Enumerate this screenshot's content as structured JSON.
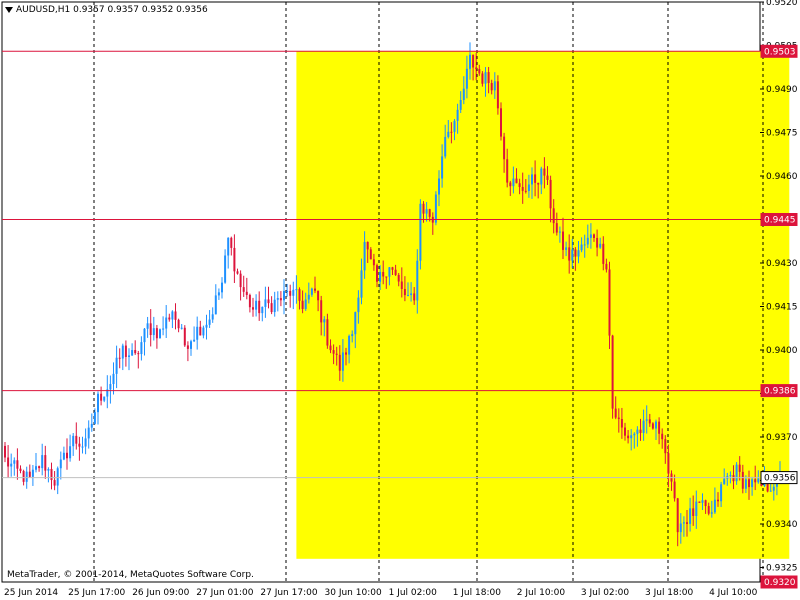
{
  "window": {
    "symbol_line": "AUDUSD,H1  0.9357 0.9357 0.9352 0.9356",
    "copyright": "MetaTrader, © 2001-2014, MetaQuotes Software Corp."
  },
  "colors": {
    "background": "#ffffff",
    "highlight": "#ffff00",
    "bull": "#1e90ff",
    "bear": "#dc143c",
    "level_line": "#dc143c",
    "grid": "#000000",
    "current_price_line": "#c0c0c0"
  },
  "chart_data": {
    "type": "candlestick",
    "title": "",
    "xlabel": "",
    "ylabel": "",
    "symbol": "AUDUSD",
    "timeframe": "H1",
    "ylim": [
      0.932,
      0.952
    ],
    "ytick_labels": [
      "0.9520",
      "0.9505",
      "0.9490",
      "0.9475",
      "0.9460",
      "0.9445",
      "0.9430",
      "0.9415",
      "0.9400",
      "0.9385",
      "0.9370",
      "0.9355",
      "0.9340",
      "0.9325"
    ],
    "x_tick_labels": [
      "25 Jun 2014",
      "25 Jun 17:00",
      "26 Jun 09:00",
      "27 Jun 01:00",
      "27 Jun 17:00",
      "30 Jun 10:00",
      "1 Jul 02:00",
      "1 Jul 18:00",
      "2 Jul 10:00",
      "3 Jul 02:00",
      "3 Jul 18:00",
      "4 Jul 10:00"
    ],
    "horizontal_levels": [
      {
        "price": 0.9503,
        "label": "0.9503"
      },
      {
        "price": 0.9445,
        "label": "0.9445"
      },
      {
        "price": 0.9386,
        "label": "0.9386"
      }
    ],
    "current_price": {
      "price": 0.9356,
      "label": "0.9356"
    },
    "axis_bottom_label": "0.9320",
    "highlight_zone": {
      "from_candle": 94,
      "to_candle": 253,
      "price_top": 0.9503,
      "price_bottom": 0.9328
    },
    "close_path": [
      [
        0,
        0.9362
      ],
      [
        4,
        0.9358
      ],
      [
        8,
        0.9355
      ],
      [
        12,
        0.9362
      ],
      [
        16,
        0.9355
      ],
      [
        20,
        0.9365
      ],
      [
        22,
        0.9369
      ],
      [
        26,
        0.9367
      ],
      [
        30,
        0.9383
      ],
      [
        34,
        0.9389
      ],
      [
        38,
        0.94
      ],
      [
        42,
        0.9397
      ],
      [
        46,
        0.9408
      ],
      [
        50,
        0.9406
      ],
      [
        54,
        0.9414
      ],
      [
        58,
        0.9402
      ],
      [
        62,
        0.9407
      ],
      [
        66,
        0.9411
      ],
      [
        70,
        0.9423
      ],
      [
        72,
        0.9438
      ],
      [
        76,
        0.9422
      ],
      [
        80,
        0.9414
      ],
      [
        84,
        0.9415
      ],
      [
        88,
        0.9417
      ],
      [
        92,
        0.942
      ],
      [
        96,
        0.9416
      ],
      [
        100,
        0.942
      ],
      [
        104,
        0.9404
      ],
      [
        108,
        0.9394
      ],
      [
        112,
        0.9406
      ],
      [
        116,
        0.9436
      ],
      [
        120,
        0.9423
      ],
      [
        124,
        0.943
      ],
      [
        128,
        0.942
      ],
      [
        132,
        0.9416
      ],
      [
        134,
        0.945
      ],
      [
        138,
        0.9445
      ],
      [
        142,
        0.9475
      ],
      [
        146,
        0.948
      ],
      [
        150,
        0.95
      ],
      [
        154,
        0.9494
      ],
      [
        158,
        0.9492
      ],
      [
        162,
        0.946
      ],
      [
        166,
        0.9455
      ],
      [
        170,
        0.9458
      ],
      [
        174,
        0.9461
      ],
      [
        178,
        0.944
      ],
      [
        182,
        0.9432
      ],
      [
        186,
        0.9435
      ],
      [
        190,
        0.944
      ],
      [
        194,
        0.943
      ],
      [
        196,
        0.938
      ],
      [
        200,
        0.937
      ],
      [
        204,
        0.9372
      ],
      [
        208,
        0.9374
      ],
      [
        212,
        0.9372
      ],
      [
        214,
        0.9358
      ],
      [
        217,
        0.934
      ],
      [
        220,
        0.9342
      ],
      [
        224,
        0.9346
      ],
      [
        228,
        0.9343
      ],
      [
        232,
        0.9355
      ],
      [
        236,
        0.9358
      ],
      [
        238,
        0.9355
      ],
      [
        242,
        0.9353
      ],
      [
        246,
        0.9353
      ],
      [
        250,
        0.9356
      ]
    ],
    "candle_count": 251,
    "grid": {
      "vertical": true,
      "horizontal": false
    }
  }
}
